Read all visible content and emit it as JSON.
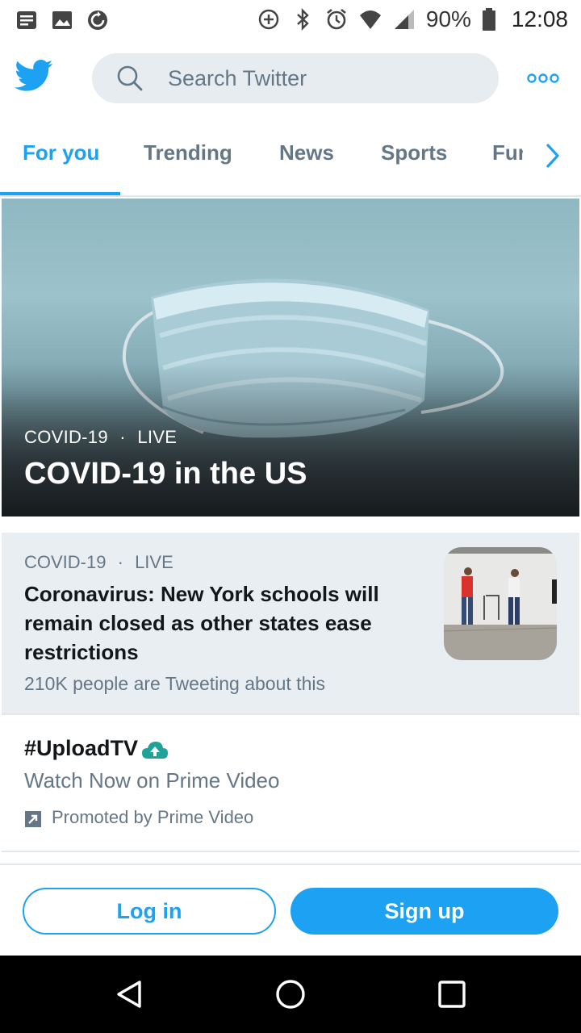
{
  "status_bar": {
    "battery": "90%",
    "time": "12:08",
    "left_icons": [
      "notes-icon",
      "image-icon",
      "sync-icon"
    ],
    "right_icons": [
      "data-saver-icon",
      "bluetooth-icon",
      "alarm-icon",
      "wifi-icon",
      "signal-icon",
      "battery-icon"
    ]
  },
  "header": {
    "logo_icon": "twitter-bird-icon",
    "search_placeholder": "Search Twitter",
    "more_icon": "more-dots-icon"
  },
  "tabs": [
    {
      "label": "For you",
      "active": true
    },
    {
      "label": "Trending",
      "active": false
    },
    {
      "label": "News",
      "active": false
    },
    {
      "label": "Sports",
      "active": false
    },
    {
      "label": "Fun",
      "active": false
    }
  ],
  "hero": {
    "category": "COVID-19",
    "separator": "·",
    "status": "LIVE",
    "title": "COVID-19 in the US"
  },
  "news_item": {
    "category": "COVID-19",
    "separator": "·",
    "status": "LIVE",
    "title": "Coronavirus: New York schools will remain closed as other states ease restrictions",
    "subtitle": "210K people are Tweeting about this"
  },
  "promoted": {
    "hashtag": "#UploadTV",
    "description": "Watch Now on Prime Video",
    "promoted_by": "Promoted by Prime Video"
  },
  "auth": {
    "login_label": "Log in",
    "signup_label": "Sign up"
  },
  "colors": {
    "accent": "#1da1f2",
    "secondary_text": "#657786",
    "card_bg": "#e9eef2"
  }
}
